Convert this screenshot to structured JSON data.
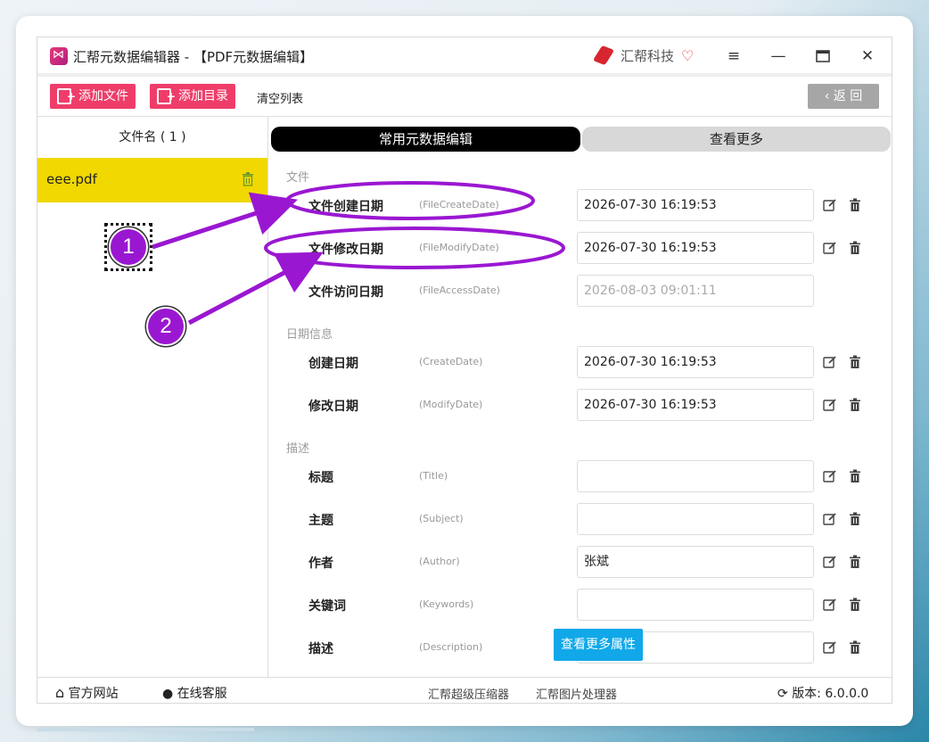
{
  "window": {
    "title": "汇帮元数据编辑器 - 【PDF元数据编辑】",
    "brand_name": "汇帮科技"
  },
  "toolbar": {
    "add_file_label": "添加文件",
    "add_folder_label": "添加目录",
    "clear_list_label": "清空列表",
    "back_label": "返 回"
  },
  "file_list": {
    "header": "文件名 ( 1 )",
    "items": [
      {
        "name": "eee.pdf"
      }
    ]
  },
  "tabs": {
    "common_label": "常用元数据编辑",
    "more_label": "查看更多"
  },
  "sections": {
    "file": "文件",
    "date_info": "日期信息",
    "description": "描述"
  },
  "rows": {
    "file_create": {
      "label": "文件创建日期",
      "key": "(FileCreateDate)",
      "value": "2026-07-30 16:19:53"
    },
    "file_modify": {
      "label": "文件修改日期",
      "key": "(FileModifyDate)",
      "value": "2026-07-30 16:19:53"
    },
    "file_access": {
      "label": "文件访问日期",
      "key": "(FileAccessDate)",
      "value": "2026-08-03 09:01:11"
    },
    "create_date": {
      "label": "创建日期",
      "key": "(CreateDate)",
      "value": "2026-07-30 16:19:53"
    },
    "modify_date": {
      "label": "修改日期",
      "key": "(ModifyDate)",
      "value": "2026-07-30 16:19:53"
    },
    "title": {
      "label": "标题",
      "key": "(Title)",
      "value": ""
    },
    "subject": {
      "label": "主题",
      "key": "(Subject)",
      "value": ""
    },
    "author": {
      "label": "作者",
      "key": "(Author)",
      "value": "张斌"
    },
    "keywords": {
      "label": "关键词",
      "key": "(Keywords)",
      "value": ""
    },
    "description": {
      "label": "描述",
      "key": "(Description)",
      "value": ""
    }
  },
  "more_attrs_label": "查看更多属性",
  "footer": {
    "website_label": "官方网站",
    "support_label": "在线客服",
    "compressor_label": "汇帮超级压缩器",
    "image_tool_label": "汇帮图片处理器",
    "version_prefix": "版本:",
    "version": "6.0.0.0"
  },
  "annotations": {
    "badge_1": "1",
    "badge_2": "2",
    "color": "#9a17d1"
  },
  "colors": {
    "accent_pink": "#ef3d6a",
    "selected_file": "#f0d800",
    "tab_active": "#000000",
    "more_attrs": "#10a8e8"
  }
}
